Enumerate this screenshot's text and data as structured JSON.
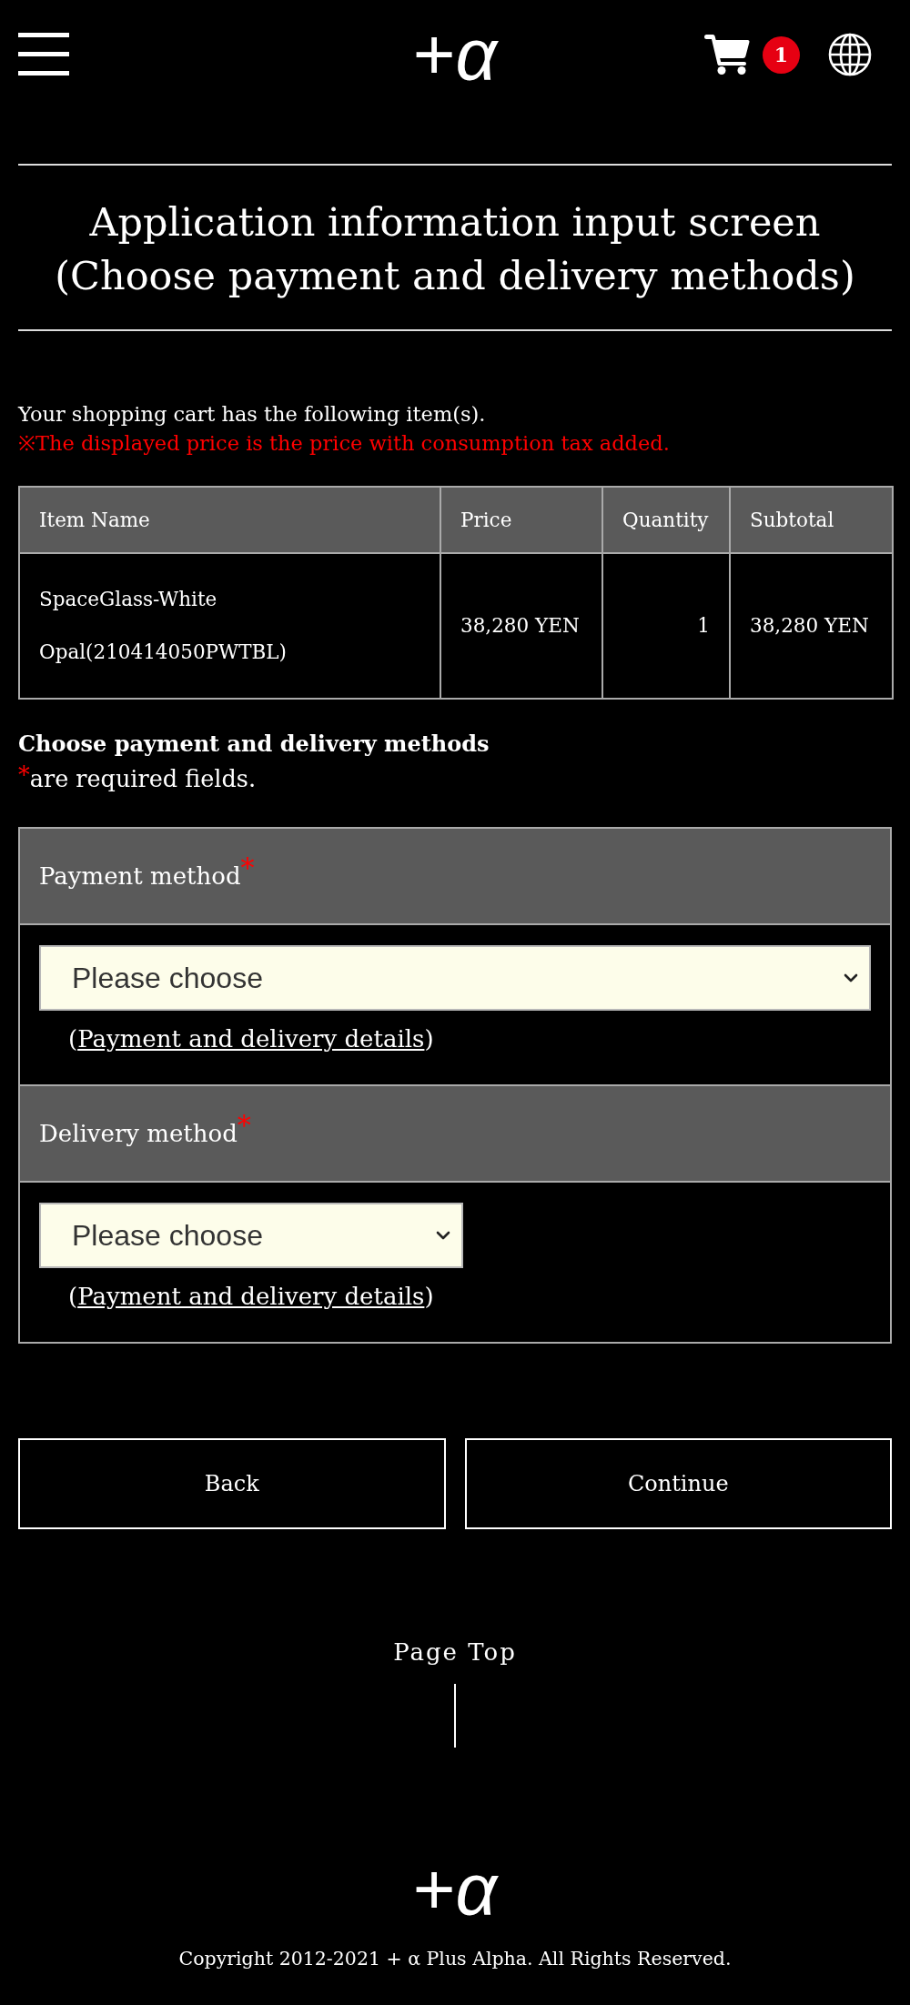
{
  "header": {
    "logo": "+*α*",
    "cart_count": "1"
  },
  "title": [
    "Application information input screen",
    "(Choose payment and delivery methods)"
  ],
  "cart_note": "Your shopping cart has the following item(s).",
  "tax_note": "※The displayed price is the price with consumption tax added.",
  "table": {
    "columns": [
      "Item Name",
      "Price",
      "Quantity",
      "Subtotal"
    ],
    "rows": [
      [
        "SpaceGlass-White Opal(210414050PWTBL)",
        "38,280 YEN",
        "1",
        "38,280 YEN"
      ]
    ]
  },
  "form": {
    "heading": "Choose payment and delivery methods",
    "required_note": {
      "mark": "*",
      "text": "are required fields."
    },
    "sections": [
      {
        "label": "Payment method",
        "required_mark": "*",
        "select": {
          "value": "Please choose"
        },
        "details": {
          "open": "(",
          "link": "Payment and delivery details",
          "close": ")"
        }
      },
      {
        "label": "Delivery method",
        "required_mark": "*",
        "select": {
          "value": "Please choose"
        },
        "details": {
          "open": "(",
          "link": "Payment and delivery details",
          "close": ")"
        }
      }
    ]
  },
  "buttons": [
    {
      "label": "Back"
    },
    {
      "label": "Continue"
    }
  ],
  "page_top": "Page Top",
  "footer": {
    "logo": "+*α*",
    "copyright": "Copyright 2012-2021 + α Plus Alpha. All Rights Reserved."
  }
}
